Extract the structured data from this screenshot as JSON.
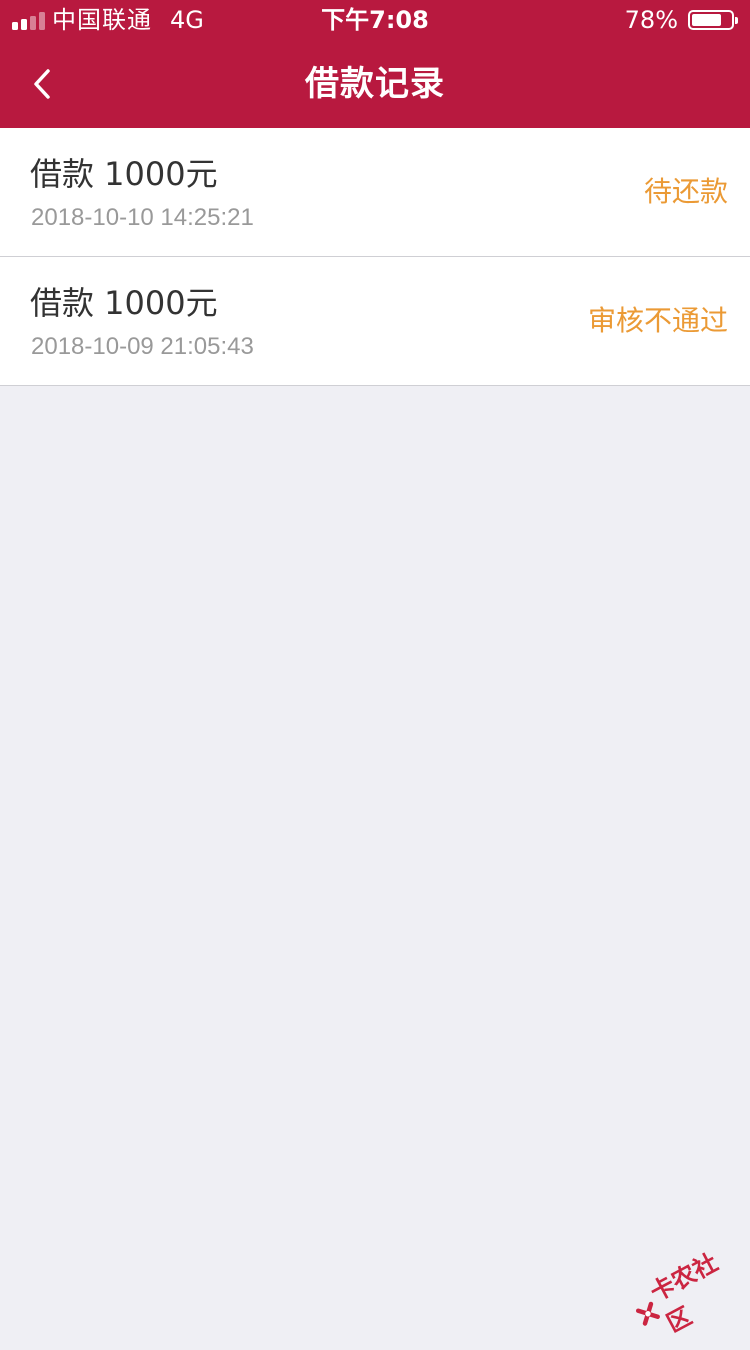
{
  "status_bar": {
    "carrier": "中国联通",
    "network": "4G",
    "time": "下午7:08",
    "battery_percent_label": "78%",
    "battery_level": 0.78
  },
  "nav": {
    "title": "借款记录",
    "back_icon": "chevron-left-icon"
  },
  "records": [
    {
      "amount": "借款 1000元",
      "time": "2018-10-10 14:25:21",
      "status": "待还款"
    },
    {
      "amount": "借款 1000元",
      "time": "2018-10-09 21:05:43",
      "status": "审核不通过"
    }
  ],
  "watermark": {
    "text": "卡农社区"
  },
  "colors": {
    "brand": "#b8193f",
    "status_text": "#eb9a35",
    "background": "#efeff4",
    "secondary_text": "#999999"
  }
}
